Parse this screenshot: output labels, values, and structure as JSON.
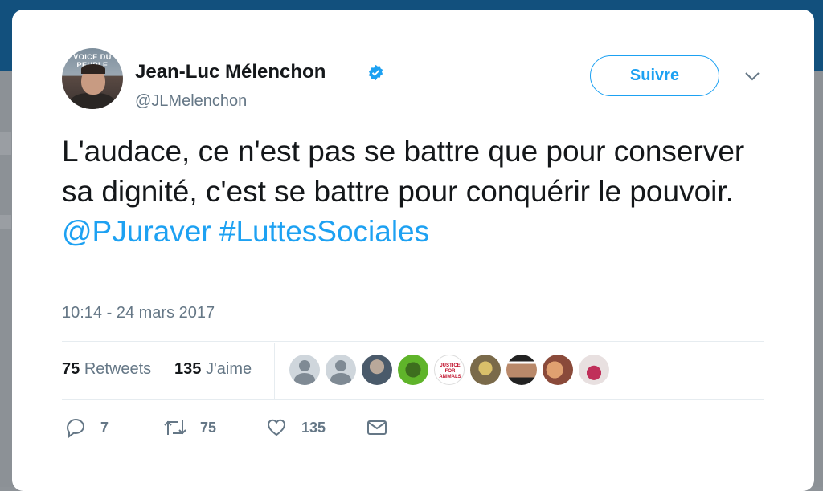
{
  "author": {
    "name": "Jean-Luc Mélenchon",
    "handle": "@JLMelenchon",
    "avatar_banner": "VOICE DU PEUPLE"
  },
  "follow_label": "Suivre",
  "tweet": {
    "text_part1": "L'audace, ce n'est pas se battre que pour conserver sa dignité, c'est se battre pour conquérir le pouvoir.",
    "mention": "@PJuraver",
    "hashtag": "#LuttesSociales",
    "timestamp": "10:14 - 24 mars 2017"
  },
  "stats": {
    "retweets_count": "75",
    "retweets_label": "Retweets",
    "likes_count": "135",
    "likes_label": "J'aime"
  },
  "likers": [
    {
      "kind": "default"
    },
    {
      "kind": "default"
    },
    {
      "kind": "photo"
    },
    {
      "kind": "photo"
    },
    {
      "kind": "logo",
      "text": "JUSTICE FOR ANIMALS"
    },
    {
      "kind": "photo"
    },
    {
      "kind": "photo"
    },
    {
      "kind": "photo"
    },
    {
      "kind": "photo"
    }
  ],
  "actions": {
    "reply_count": "7",
    "retweet_count": "75",
    "like_count": "135"
  },
  "colors": {
    "accent": "#1da1f2",
    "text": "#14171a",
    "secondary": "#657786"
  }
}
